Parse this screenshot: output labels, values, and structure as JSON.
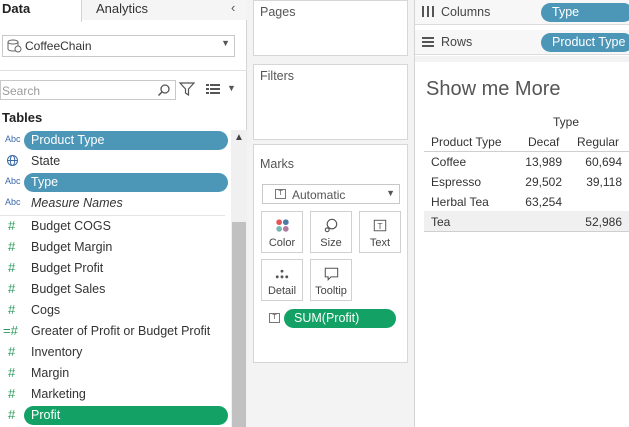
{
  "left_panel": {
    "tab_data": "Data",
    "tab_analytics": "Analytics",
    "datasource": "CoffeeChain",
    "search_placeholder": "Search",
    "tables_heading": "Tables",
    "fields": [
      {
        "type_icon": "Abc",
        "name": "Product Type",
        "selected": "blue"
      },
      {
        "type_icon": "globe",
        "name": "State"
      },
      {
        "type_icon": "Abc",
        "name": "Type",
        "selected": "blue"
      },
      {
        "type_icon": "Abc",
        "name": "Measure Names",
        "italic": true
      },
      {
        "type_icon": "#",
        "name": "Budget COGS"
      },
      {
        "type_icon": "#",
        "name": "Budget Margin"
      },
      {
        "type_icon": "#",
        "name": "Budget Profit"
      },
      {
        "type_icon": "#",
        "name": "Budget Sales"
      },
      {
        "type_icon": "#",
        "name": "Cogs"
      },
      {
        "type_icon": "=#",
        "name": "Greater of Profit or Budget Profit"
      },
      {
        "type_icon": "#",
        "name": "Inventory"
      },
      {
        "type_icon": "#",
        "name": "Margin"
      },
      {
        "type_icon": "#",
        "name": "Marketing"
      },
      {
        "type_icon": "#",
        "name": "Profit",
        "selected": "green"
      }
    ]
  },
  "cards": {
    "pages": "Pages",
    "filters": "Filters",
    "marks": "Marks",
    "mark_type": "Automatic",
    "buttons": {
      "color": "Color",
      "size": "Size",
      "text": "Text",
      "detail": "Detail",
      "tooltip": "Tooltip"
    },
    "sum_pill": "SUM(Profit)"
  },
  "shelves": {
    "columns_label": "Columns",
    "columns_pill": "Type",
    "rows_label": "Rows",
    "rows_pill": "Product Type"
  },
  "view": {
    "title": "Show me More",
    "column_header": "Type",
    "row_header": "Product Type",
    "columns": [
      "Decaf",
      "Regular"
    ],
    "rows": [
      {
        "name": "Coffee",
        "decaf": "13,989",
        "regular": "60,694"
      },
      {
        "name": "Espresso",
        "decaf": "29,502",
        "regular": "39,118"
      },
      {
        "name": "Herbal Tea",
        "decaf": "63,254",
        "regular": ""
      },
      {
        "name": "Tea",
        "decaf": "",
        "regular": "52,986"
      }
    ]
  },
  "colors": {
    "dimension_pill": "#4c96b8",
    "measure_pill": "#13a165"
  }
}
